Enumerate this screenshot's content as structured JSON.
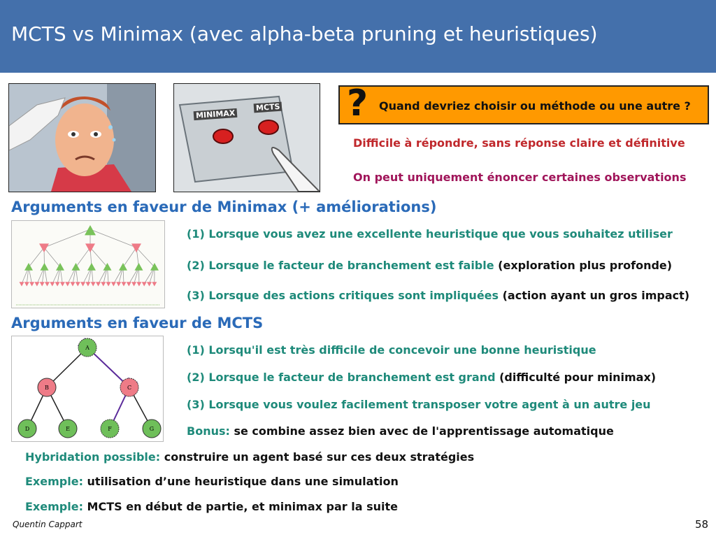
{
  "slide": {
    "title": "MCTS vs Minimax (avec alpha-beta pruning et heuristiques)",
    "author": "Quentin Cappart",
    "page_number": "58"
  },
  "meme": {
    "button_left": "MINIMAX",
    "button_right": "MCTS"
  },
  "question": {
    "mark": "?",
    "text": "Quand devriez choisir ou méthode ou une autre ?",
    "answer_1": "Difficile à répondre, sans réponse claire et définitive",
    "answer_2": "On peut uniquement énoncer certaines observations"
  },
  "minimax_section": {
    "heading": "Arguments en faveur de Minimax (+ améliorations)",
    "items": [
      {
        "teal": "(1) Lorsque vous avez une excellente heuristique que vous souhaitez utiliser",
        "dark": ""
      },
      {
        "teal": "(2) Lorsque le facteur de branchement est faible",
        "dark": " (exploration plus profonde)"
      },
      {
        "teal": "(3) Lorsque des actions critiques sont impliquées",
        "dark": " (action ayant un gros impact)"
      }
    ]
  },
  "mcts_section": {
    "heading": "Arguments en faveur de MCTS",
    "items": [
      {
        "teal": "(1) Lorsqu'il est très difficile de concevoir une bonne heuristique",
        "dark": ""
      },
      {
        "teal": "(2) Lorsque le facteur de branchement est grand",
        "dark": " (difficulté pour minimax)"
      },
      {
        "teal": "(3) Lorsque vous voulez facilement transposer votre agent à un autre jeu",
        "dark": ""
      },
      {
        "teal": "Bonus:",
        "dark": " se combine assez bien avec de l'apprentissage automatique"
      }
    ],
    "tree_nodes": [
      "A",
      "B",
      "C",
      "D",
      "E",
      "F",
      "G"
    ]
  },
  "hybrid": [
    {
      "label": "Hybridation possible:",
      "text": " construire un agent basé sur ces deux stratégies"
    },
    {
      "label": "Exemple:",
      "text": " utilisation d’une heuristique dans une simulation"
    },
    {
      "label": "Exemple:",
      "text": " MCTS en début de partie, et minimax par la suite"
    }
  ],
  "colors": {
    "header": "#4470ab",
    "question_box": "#ff9900",
    "section_heading": "#2a6ab8",
    "teal_text": "#1e8a7a",
    "red_text": "#c0282c",
    "purple_text": "#a0155a"
  }
}
